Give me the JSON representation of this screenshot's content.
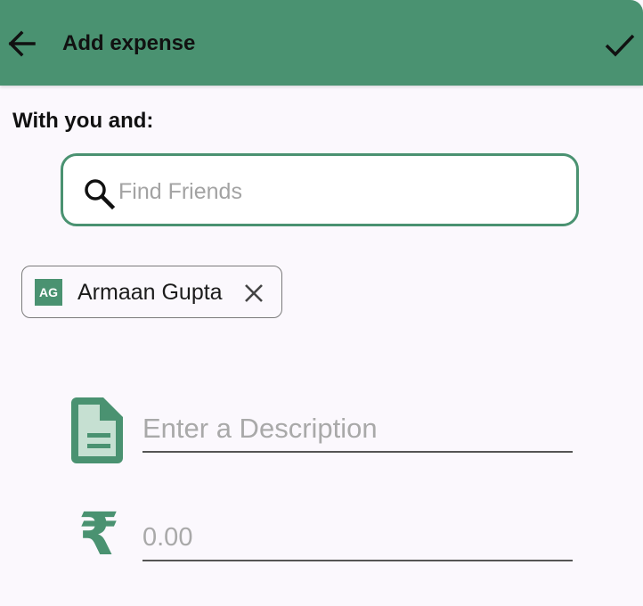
{
  "app_bar": {
    "title": "Add expense",
    "back_icon": "arrow-left-icon",
    "confirm_icon": "check-icon",
    "color": "#4a9271"
  },
  "with_label": "With you and:",
  "search": {
    "placeholder": "Find Friends",
    "value": "",
    "icon": "search-icon"
  },
  "selected_friends": [
    {
      "initials": "AG",
      "name": "Armaan Gupta",
      "remove_icon": "close-icon"
    }
  ],
  "description": {
    "placeholder": "Enter a Description",
    "value": "",
    "icon": "document-icon"
  },
  "amount": {
    "currency_symbol": "₹",
    "placeholder": "0.00",
    "value": ""
  },
  "colors": {
    "accent": "#4a9271",
    "accent_light": "#c6e0d2",
    "background": "#fbf8fd"
  }
}
